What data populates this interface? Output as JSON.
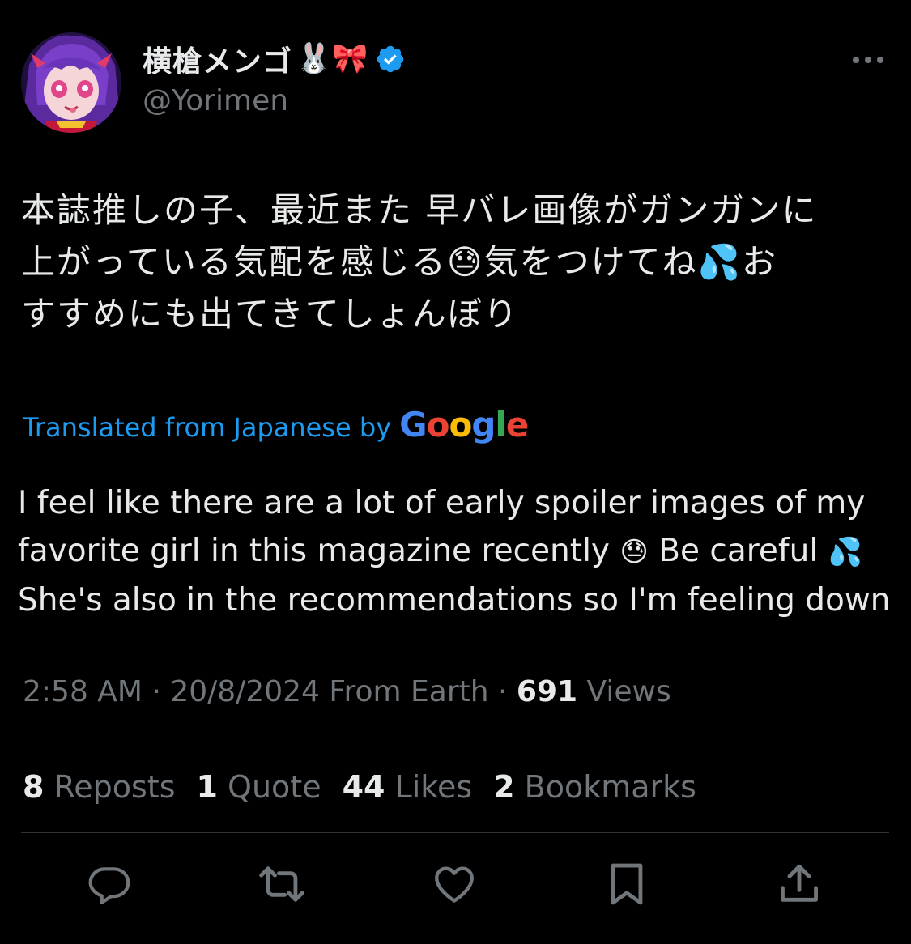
{
  "author": {
    "display_name": "横槍メンゴ",
    "name_emojis": "🐰🎀",
    "handle": "@Yorimen",
    "verified": true
  },
  "tweet": {
    "text_lines": [
      "本誌推しの子、最近また 早バレ画像がガンガンに",
      "上がっている気配を感じる😓気をつけてね💦お",
      "すすめにも出てきてしょんぼり"
    ],
    "translated_label": "Translated from Japanese by",
    "translator_brand": "Google",
    "translation": {
      "line1": "I feel like there are a lot of early spoiler images of my",
      "line2a": "favorite girl in this magazine recently",
      "emoji1": "😓",
      "line2b": "Be careful",
      "emoji2": "💦",
      "line3": "She's also in the recommendations so I'm feeling down"
    }
  },
  "meta": {
    "time": "2:58 AM",
    "date": "20/8/2024",
    "location": "From Earth",
    "views_count": "691",
    "views_label": "Views"
  },
  "stats": {
    "reposts_count": "8",
    "reposts_label": "Reposts",
    "quotes_count": "1",
    "quotes_label": "Quote",
    "likes_count": "44",
    "likes_label": "Likes",
    "bookmarks_count": "2",
    "bookmarks_label": "Bookmarks"
  },
  "colors": {
    "background": "#000000",
    "text_primary": "#e7e9ea",
    "text_secondary": "#71767b",
    "accent_blue": "#1d9bf0",
    "divider": "#2f3336"
  },
  "icons": {
    "more": "more-horizontal-icon",
    "reply": "reply-icon",
    "repost": "repost-icon",
    "like": "heart-icon",
    "bookmark": "bookmark-icon",
    "share": "share-icon",
    "verified": "verified-badge-icon"
  }
}
